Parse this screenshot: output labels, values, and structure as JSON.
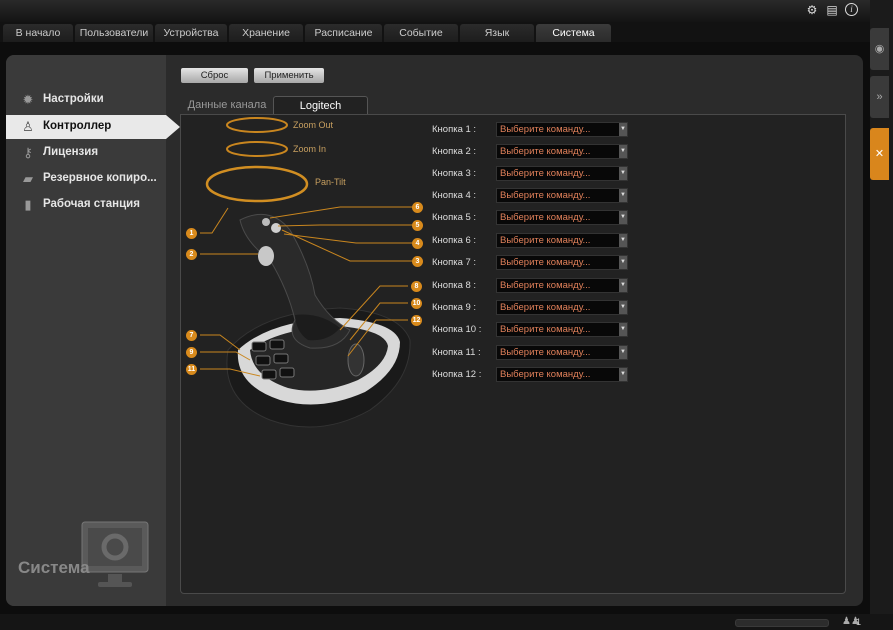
{
  "header": {
    "icons": [
      "settings-icon",
      "document-icon",
      "info-icon"
    ]
  },
  "tabs": [
    {
      "label": "В начало"
    },
    {
      "label": "Пользователи"
    },
    {
      "label": "Устройства"
    },
    {
      "label": "Хранение"
    },
    {
      "label": "Расписание"
    },
    {
      "label": "Событие"
    },
    {
      "label": "Язык"
    },
    {
      "label": "Система",
      "active": true
    }
  ],
  "sidebar": {
    "items": [
      {
        "label": "Настройки",
        "icon": "gear-icon"
      },
      {
        "label": "Контроллер",
        "icon": "joystick-icon",
        "active": true
      },
      {
        "label": "Лицензия",
        "icon": "key-icon"
      },
      {
        "label": "Резервное копиро...",
        "icon": "folder-icon"
      },
      {
        "label": "Рабочая станция",
        "icon": "computer-icon"
      }
    ],
    "footer_label": "Система"
  },
  "toolbar": {
    "reset_label": "Сброс",
    "apply_label": "Применить"
  },
  "subtabs": [
    {
      "label": "Данные канала"
    },
    {
      "label": "Logitech",
      "active": true
    }
  ],
  "ptz_labels": {
    "zoom_out": "Zoom Out",
    "zoom_in": "Zoom In",
    "pan_tilt": "Pan-Tilt"
  },
  "button_numbers": [
    "1",
    "2",
    "3",
    "4",
    "5",
    "6",
    "7",
    "8",
    "9",
    "10",
    "11",
    "12"
  ],
  "buttons": [
    {
      "label": "Кнопка 1 :",
      "value": "Выберите команду..."
    },
    {
      "label": "Кнопка 2 :",
      "value": "Выберите команду..."
    },
    {
      "label": "Кнопка 3 :",
      "value": "Выберите команду..."
    },
    {
      "label": "Кнопка 4 :",
      "value": "Выберите команду..."
    },
    {
      "label": "Кнопка 5 :",
      "value": "Выберите команду..."
    },
    {
      "label": "Кнопка 6 :",
      "value": "Выберите команду..."
    },
    {
      "label": "Кнопка 7 :",
      "value": "Выберите команду..."
    },
    {
      "label": "Кнопка 8 :",
      "value": "Выберите команду..."
    },
    {
      "label": "Кнопка 9 :",
      "value": "Выберите команду..."
    },
    {
      "label": "Кнопка 10 :",
      "value": "Выберите команду..."
    },
    {
      "label": "Кнопка 11 :",
      "value": "Выберите команду..."
    },
    {
      "label": "Кнопка 12 :",
      "value": "Выберите команду..."
    }
  ],
  "status": {
    "count": "1"
  },
  "colors": {
    "accent": "#d88a1c",
    "select_text": "#e0805a"
  }
}
